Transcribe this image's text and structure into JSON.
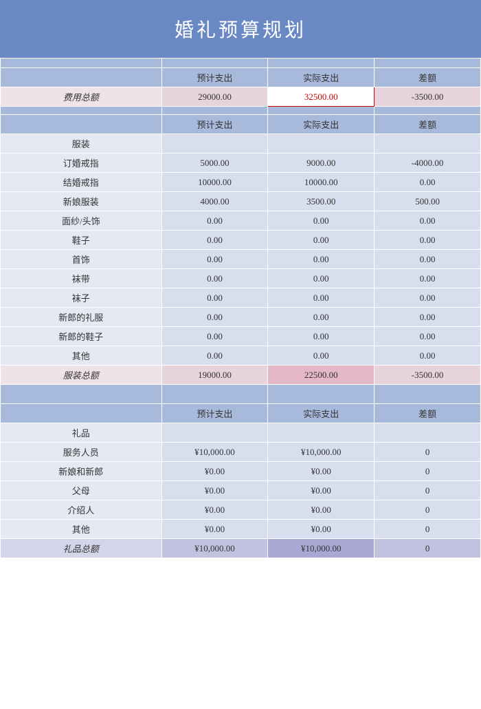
{
  "title": "婚礼预算规划",
  "columns": {
    "expected": "预计支出",
    "actual": "实际支出",
    "diff": "差额"
  },
  "totalRow": {
    "label": "费用总额",
    "expected": "29000.00",
    "actual": "32500.00",
    "diff": "-3500.00"
  },
  "section1": {
    "name": "服装",
    "rows": [
      {
        "label": "订婚戒指",
        "expected": "5000.00",
        "actual": "9000.00",
        "diff": "-4000.00"
      },
      {
        "label": "结婚戒指",
        "expected": "10000.00",
        "actual": "10000.00",
        "diff": "0.00"
      },
      {
        "label": "新娘服装",
        "expected": "4000.00",
        "actual": "3500.00",
        "diff": "500.00"
      },
      {
        "label": "面纱/头饰",
        "expected": "0.00",
        "actual": "0.00",
        "diff": "0.00"
      },
      {
        "label": "鞋子",
        "expected": "0.00",
        "actual": "0.00",
        "diff": "0.00"
      },
      {
        "label": "首饰",
        "expected": "0.00",
        "actual": "0.00",
        "diff": "0.00"
      },
      {
        "label": "袜带",
        "expected": "0.00",
        "actual": "0.00",
        "diff": "0.00"
      },
      {
        "label": "袜子",
        "expected": "0.00",
        "actual": "0.00",
        "diff": "0.00"
      },
      {
        "label": "新郎的礼服",
        "expected": "0.00",
        "actual": "0.00",
        "diff": "0.00"
      },
      {
        "label": "新郎的鞋子",
        "expected": "0.00",
        "actual": "0.00",
        "diff": "0.00"
      },
      {
        "label": "其他",
        "expected": "0.00",
        "actual": "0.00",
        "diff": "0.00"
      }
    ],
    "subtotal": {
      "label": "服装总额",
      "expected": "19000.00",
      "actual": "22500.00",
      "diff": "-3500.00"
    }
  },
  "section2": {
    "name": "礼品",
    "rows": [
      {
        "label": "服务人员",
        "expected": "¥10,000.00",
        "actual": "¥10,000.00",
        "diff": "0"
      },
      {
        "label": "新娘和新郎",
        "expected": "¥0.00",
        "actual": "¥0.00",
        "diff": "0"
      },
      {
        "label": "父母",
        "expected": "¥0.00",
        "actual": "¥0.00",
        "diff": "0"
      },
      {
        "label": "介绍人",
        "expected": "¥0.00",
        "actual": "¥0.00",
        "diff": "0"
      },
      {
        "label": "其他",
        "expected": "¥0.00",
        "actual": "¥0.00",
        "diff": "0"
      }
    ],
    "subtotal": {
      "label": "礼品总额",
      "expected": "¥10,000.00",
      "actual": "¥10,000.00",
      "diff": "0"
    }
  }
}
